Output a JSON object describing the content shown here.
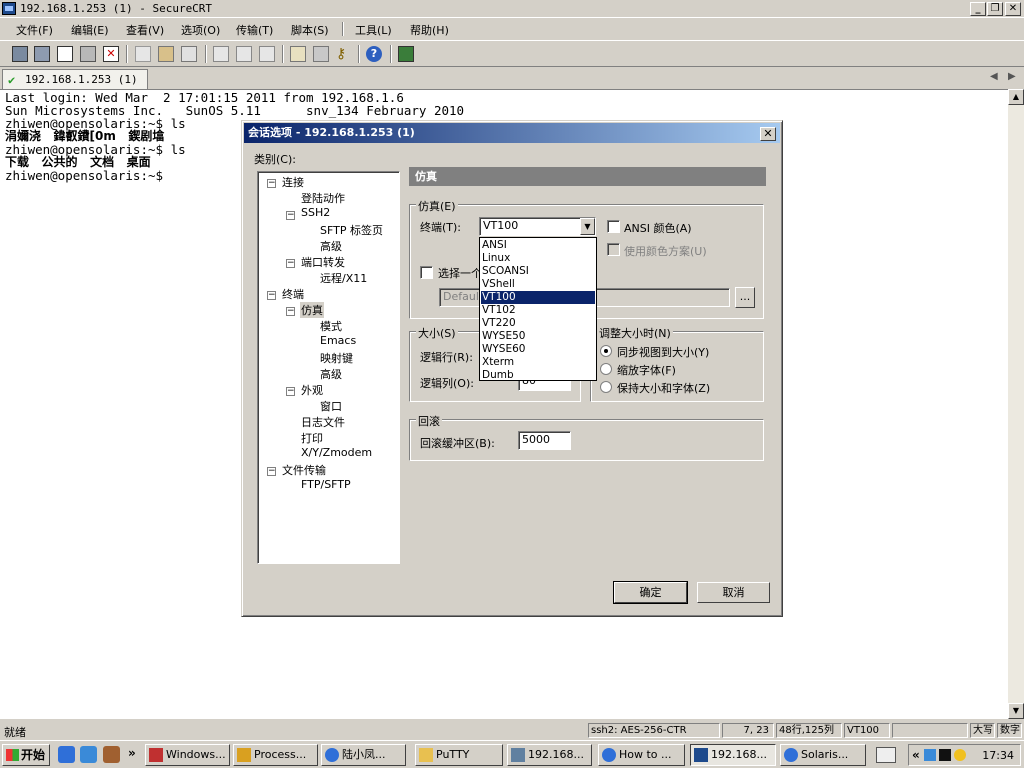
{
  "window": {
    "title": "192.168.1.253 (1) - SecureCRT"
  },
  "menu": [
    "文件(F)",
    "编辑(E)",
    "查看(V)",
    "选项(O)",
    "传输(T)",
    "脚本(S)",
    "工具(L)",
    "帮助(H)"
  ],
  "tab": {
    "label": "192.168.1.253 (1)"
  },
  "terminal": {
    "lines": [
      "Last login: Wed Mar  2 17:01:15 2011 from 192.168.1.6",
      "Sun Microsystems Inc.   SunOS 5.11      snv_134 February 2010",
      "zhiwen@opensolaris:~$ ls",
      "涓嬭浇   鍏叡鐨[0m   鍥剧墖",
      "zhiwen@opensolaris:~$ ls",
      "下载   公共的   文档   桌面",
      "zhiwen@opensolaris:~$"
    ]
  },
  "status": {
    "ready": "就绪",
    "cipher": "ssh2: AES-256-CTR",
    "cursor": "7,  23",
    "size": "48行,125列",
    "emulation": "VT100",
    "caps": "大写",
    "num": "数字"
  },
  "taskbar": {
    "start": "开始",
    "tasks": [
      "Windows...",
      "Process...",
      "陆小凤...",
      "PuTTY",
      "192.168...",
      "How to ...",
      "192.168...",
      "Solaris..."
    ],
    "time": "17:34"
  },
  "dialog": {
    "title": "会话选项 - 192.168.1.253 (1)",
    "category_label": "类别(C):",
    "tree": {
      "connection": "连接",
      "login_actions": "登陆动作",
      "ssh2": "SSH2",
      "sftp_tab": "SFTP 标签页",
      "advanced1": "高级",
      "port_forward": "端口转发",
      "remote_x11": "远程/X11",
      "terminal": "终端",
      "emulation": "仿真",
      "modes": "模式",
      "emacs": "Emacs",
      "mapped_keys": "映射键",
      "advanced2": "高级",
      "appearance": "外观",
      "window": "窗口",
      "log_file": "日志文件",
      "print": "打印",
      "xyz": "X/Y/Zmodem",
      "file_transfer": "文件传输",
      "ftp_sftp": "FTP/SFTP"
    },
    "panel_title": "仿真",
    "emulation_group": "仿真(E)",
    "terminal_label": "终端(T):",
    "terminal_value": "VT100",
    "ansi_color": "ANSI 颜色(A)",
    "use_color_scheme": "使用颜色方案(U)",
    "select_alt": "选择一个",
    "default_field": "Default",
    "ellipsis": "...",
    "size_group": "大小(S)",
    "logical_rows": "逻辑行(R):",
    "logical_cols": "逻辑列(O):",
    "cols_value": "80",
    "resize_group": "调整大小时(N)",
    "resize_opt1": "同步视图到大小(Y)",
    "resize_opt2": "缩放字体(F)",
    "resize_opt3": "保持大小和字体(Z)",
    "scroll_group": "回滚",
    "scrollback_label": "回滚缓冲区(B):",
    "scrollback_value": "5000",
    "ok": "确定",
    "cancel": "取消",
    "terminal_options": [
      "ANSI",
      "Linux",
      "SCOANSI",
      "VShell",
      "VT100",
      "VT102",
      "VT220",
      "WYSE50",
      "WYSE60",
      "Xterm",
      "Dumb"
    ]
  }
}
